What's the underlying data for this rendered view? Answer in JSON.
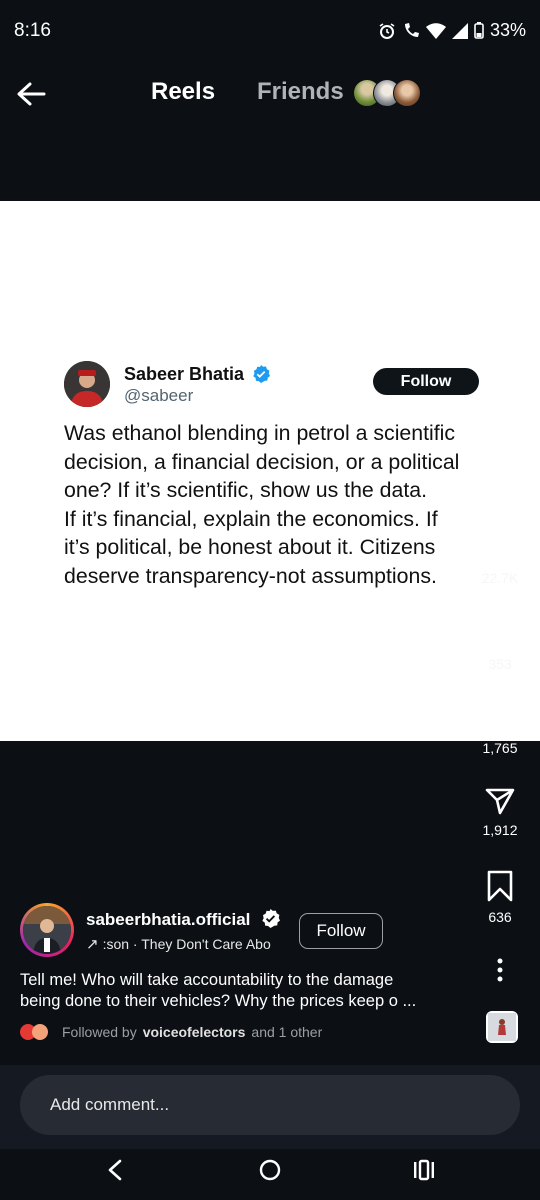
{
  "status_bar": {
    "time": "8:16",
    "battery": "33%"
  },
  "header": {
    "back_icon": "arrow-left-icon",
    "tab_reels": "Reels",
    "tab_friends": "Friends"
  },
  "post": {
    "tweet": {
      "name": "Sabeer Bhatia",
      "handle": "@sabeer",
      "follow_label": "Follow",
      "text_lines": [
        "Was ethanol blending in petrol a scientific",
        "decision, a financial decision, or a political",
        "one? If it’s scientific, show us the data.",
        "If it’s financial, explain the economics. If",
        "it’s political, be honest about it. Citizens",
        "deserve transparency-not assumptions."
      ]
    }
  },
  "actions": {
    "like_count": "22.7K",
    "comment_count": "353",
    "repost_count": "1,765",
    "share_count": "1,912",
    "save_count": "636",
    "like_icon": "heart-icon",
    "comment_icon": "comment-icon",
    "repost_icon": "repost-icon",
    "share_icon": "send-icon",
    "save_icon": "bookmark-icon",
    "more_icon": "more-vertical-icon"
  },
  "author": {
    "username": "sabeerbhatia.official",
    "follow_label": "Follow",
    "audio_text": ":son · They Don't Care Abo"
  },
  "caption": {
    "line1": "Tell me! Who will take accountability to the damage",
    "line2": "being done to their vehicles? Why the prices keep o ..."
  },
  "followed_by": {
    "prefix": "Followed by",
    "user": "voiceofelectors",
    "suffix": "and 1 other"
  },
  "comment": {
    "placeholder": "Add comment..."
  },
  "colors": {
    "background": "#0c0f14",
    "verified": "#1d9bf0",
    "comment_bar": "#151a22"
  }
}
